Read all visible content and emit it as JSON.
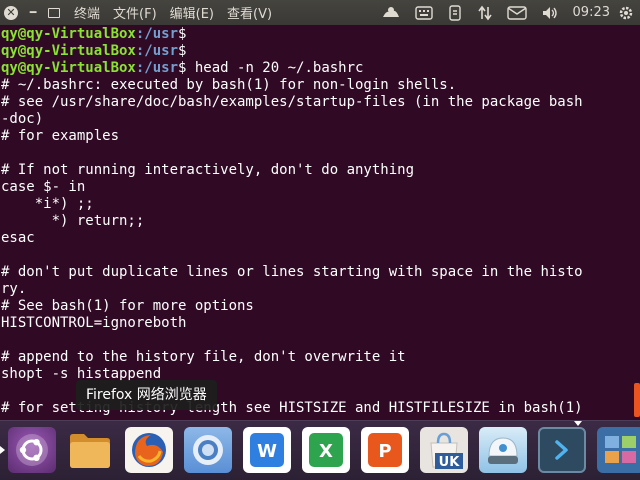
{
  "window": {
    "menus": [
      "终端",
      "文件(F)",
      "编辑(E)",
      "查看(V)"
    ]
  },
  "tray": {
    "time": "09:23",
    "icons": [
      "brightness-icon",
      "keyboard-icon",
      "battery-icon",
      "network-transfer-icon",
      "mail-icon",
      "volume-icon",
      "gear-icon"
    ]
  },
  "terminal": {
    "prompt_user": "qy@qy-VirtualBox",
    "prompt_path": ":/usr",
    "prompt_symbol": "$",
    "prompts": [
      {
        "command": ""
      },
      {
        "command": ""
      },
      {
        "command": " head -n 20 ~/.bashrc"
      }
    ],
    "output": [
      "# ~/.bashrc: executed by bash(1) for non-login shells.",
      "# see /usr/share/doc/bash/examples/startup-files (in the package bash",
      "-doc)",
      "# for examples",
      "",
      "# If not running interactively, don't do anything",
      "case $- in",
      "    *i*) ;;",
      "      *) return;;",
      "esac",
      "",
      "# don't put duplicate lines or lines starting with space in the histo",
      "ry.",
      "# See bash(1) for more options",
      "HISTCONTROL=ignoreboth",
      "",
      "# append to the history file, don't overwrite it",
      "shopt -s histappend",
      "",
      "# for setting history length see HISTSIZE and HISTFILESIZE in bash(1)"
    ]
  },
  "tooltip": {
    "text": "Firefox 网络浏览器"
  },
  "dock": {
    "items": [
      {
        "name": "ubuntu-dash-icon",
        "color": "#7b3b8f"
      },
      {
        "name": "files-icon",
        "color": "#e8a951"
      },
      {
        "name": "firefox-icon",
        "color": "#e65a1f"
      },
      {
        "name": "chromium-icon",
        "color": "#5a8fd6"
      },
      {
        "name": "wps-writer-icon",
        "color": "#2f7fe0",
        "label": "W"
      },
      {
        "name": "wps-spreadsheets-icon",
        "color": "#2ea44f",
        "label": "X"
      },
      {
        "name": "wps-presentation-icon",
        "color": "#e8581c",
        "label": "P"
      },
      {
        "name": "software-center-icon",
        "color": "#e8e4df",
        "label": "UK"
      },
      {
        "name": "software-updater-icon",
        "color": "#6aa9d9"
      },
      {
        "name": "terminal-icon",
        "color": "#3e5c74"
      },
      {
        "name": "workspace-switcher-icon",
        "color": "#3a6ea5"
      }
    ]
  }
}
